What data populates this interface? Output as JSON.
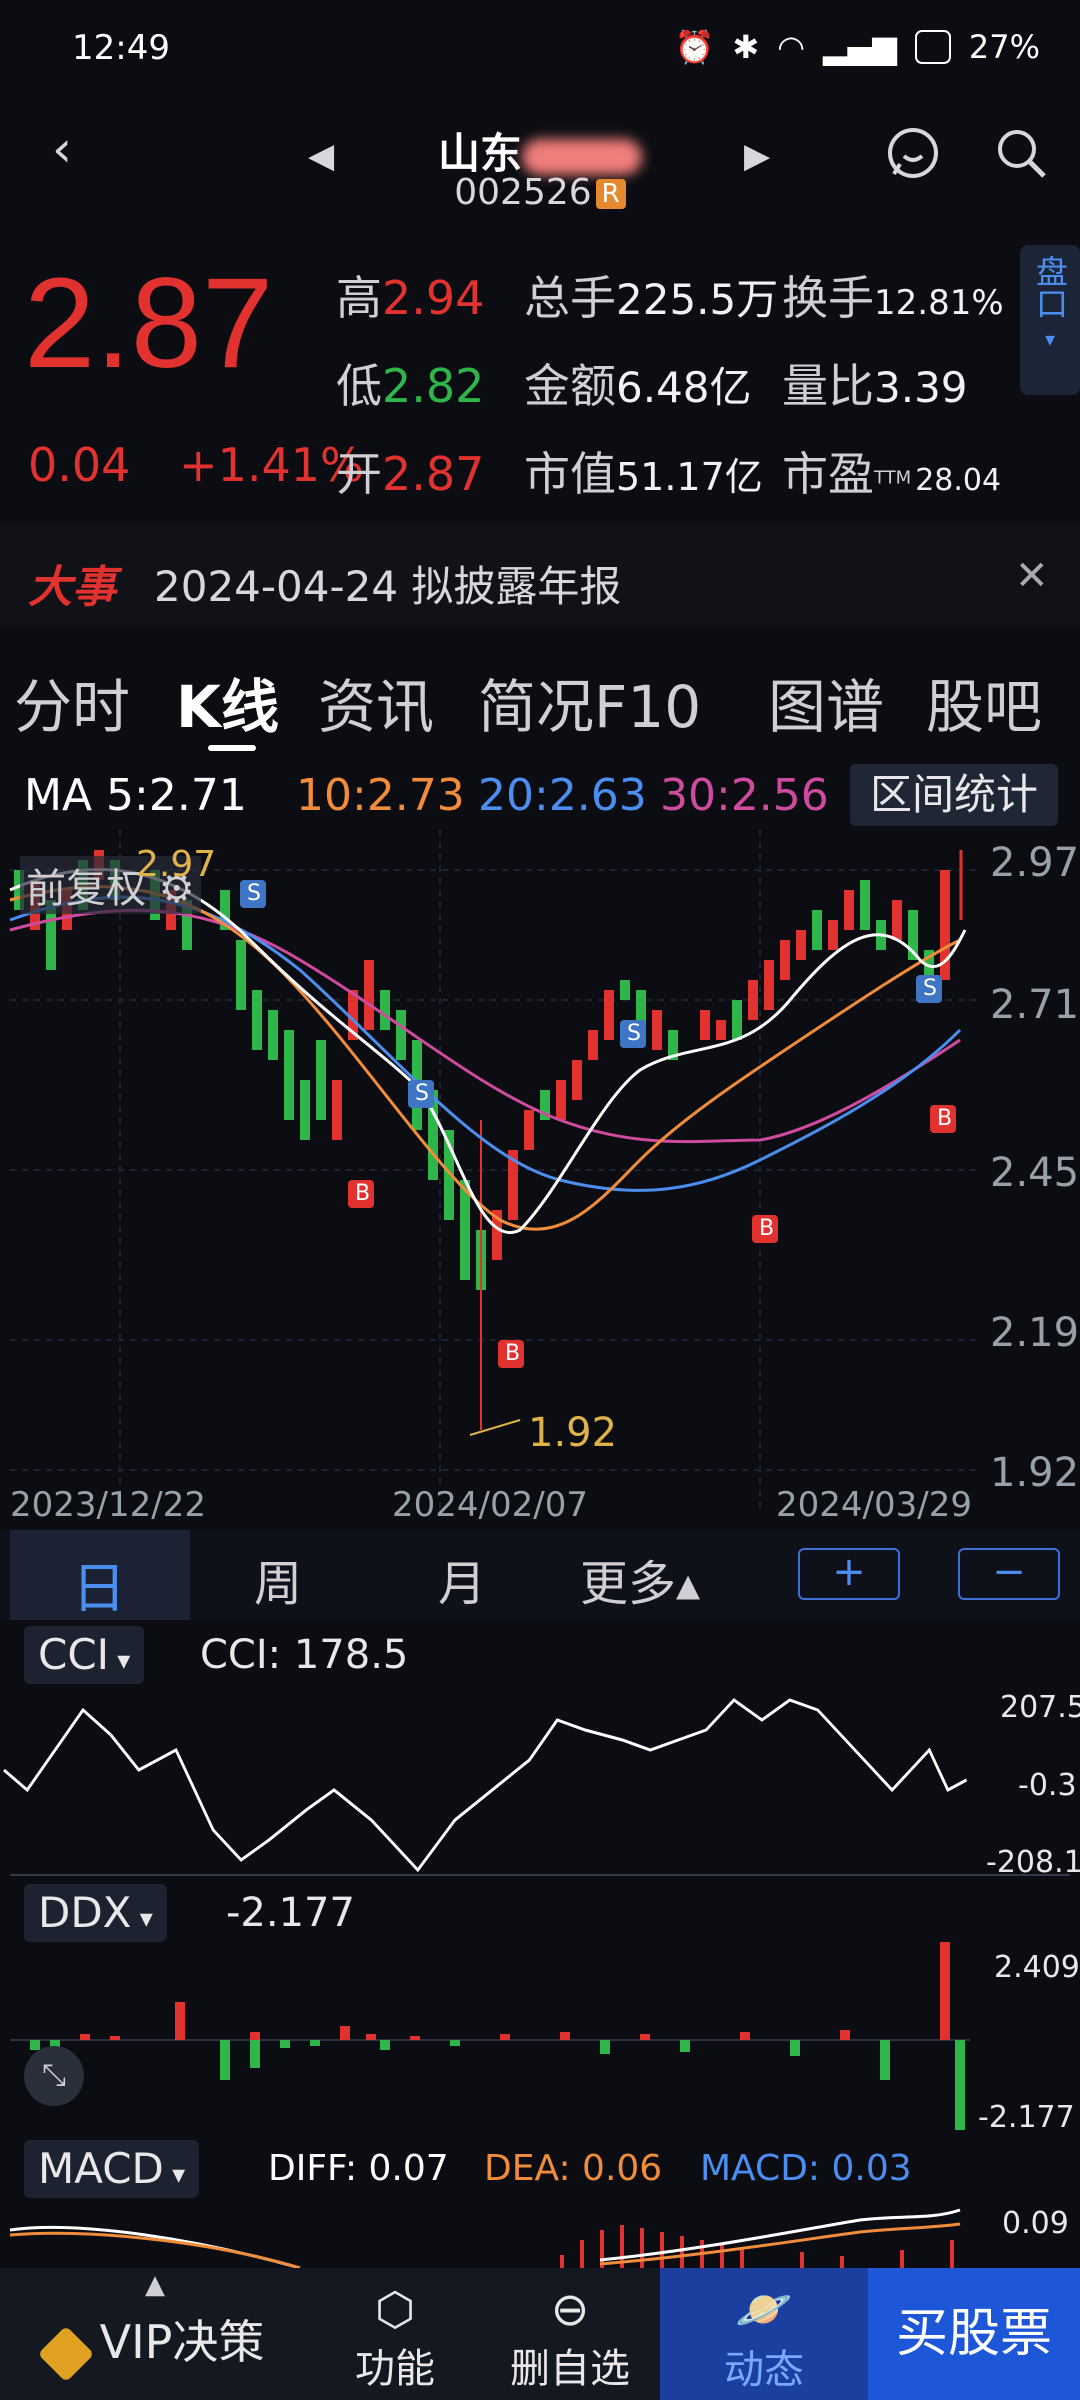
{
  "status_bar": {
    "time": "12:49",
    "battery": "27%"
  },
  "header": {
    "name": "山东",
    "code": "002526",
    "code_badge": "R"
  },
  "quote": {
    "price": "2.87",
    "change": "0.04",
    "change_pct": "+1.41%",
    "rows": [
      {
        "l1": "高",
        "v1": "2.94",
        "l2": "总手",
        "v2": "225.5万",
        "l3": "换手",
        "v3": "12.81%"
      },
      {
        "l1": "低",
        "v1": "2.82",
        "l2": "金额",
        "v2": "6.48亿",
        "l3": "量比",
        "v3": "3.39"
      },
      {
        "l1": "开",
        "v1": "2.87",
        "l2": "市值",
        "v2": "51.17亿",
        "l3": "市盈",
        "v3": "28.04",
        "ttm": "TTM"
      }
    ],
    "pankou": "盘口"
  },
  "event": {
    "tag": "大事",
    "text": "2024-04-24 拟披露年报"
  },
  "tabs": [
    "分时",
    "K线",
    "资讯",
    "简况F10",
    "图谱",
    "股吧"
  ],
  "ma": {
    "ma5": "MA 5:2.71",
    "ma10": "10:2.73",
    "ma20": "20:2.63",
    "ma30": "30:2.56",
    "stat_button": "区间统计"
  },
  "kchart": {
    "adjust_label": "前复权",
    "y_ticks": [
      "2.97",
      "2.71",
      "2.45",
      "2.19",
      "1.92"
    ],
    "x_ticks": [
      "2023/12/22",
      "2024/02/07",
      "2024/03/29"
    ],
    "high_label": "2.97",
    "low_label": "1.92",
    "signal_buy": "B",
    "signal_sell": "S"
  },
  "period": {
    "items": [
      "日",
      "周",
      "月",
      "更多▴"
    ],
    "plus": "+",
    "minus": "−"
  },
  "cci": {
    "label": "CCI",
    "value": "CCI:  178.5",
    "axis": [
      "207.5",
      "-0.3",
      "-208.1"
    ]
  },
  "ddx": {
    "label": "DDX",
    "value": "-2.177",
    "axis": [
      "2.409",
      "-2.177"
    ]
  },
  "macd": {
    "label": "MACD",
    "diff": "DIFF: 0.07",
    "dea": "DEA: 0.06",
    "macd": "MACD: 0.03",
    "axis": "0.09"
  },
  "bottom_nav": {
    "vip": "VIP决策",
    "func": "功能",
    "del": "删自选",
    "dyn": "动态",
    "buy": "买股票"
  },
  "colors": {
    "up": "#e2322f",
    "down": "#2fb64a",
    "ma5": "#ffffff",
    "ma10": "#f08c3a",
    "ma20": "#4b8ef0",
    "ma30": "#d04aa0"
  }
}
